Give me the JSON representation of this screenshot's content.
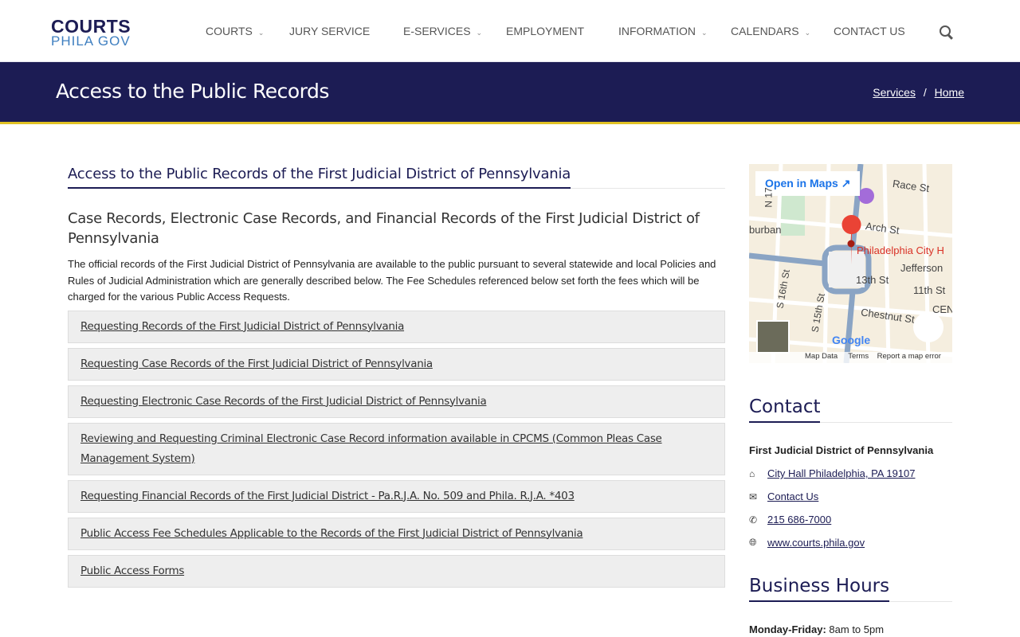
{
  "logo": {
    "line1": "COURTS",
    "line2": "PHILA GOV"
  },
  "nav": [
    {
      "label": "COURTS",
      "dropdown": true
    },
    {
      "label": "JURY SERVICE"
    },
    {
      "label": "E-SERVICES",
      "dropdown": true
    },
    {
      "label": "EMPLOYMENT"
    },
    {
      "label": "INFORMATION",
      "dropdown": true
    },
    {
      "label": "CALENDARS",
      "dropdown": true
    },
    {
      "label": "CONTACT US"
    }
  ],
  "banner": {
    "title": "Access to the Public Records",
    "breadcrumb": [
      "Services",
      "Home"
    ],
    "sep": "/"
  },
  "main": {
    "title": "Access to the Public Records of the First Judicial District of Pennsylvania",
    "subtitle": "Case Records, Electronic Case Records, and Financial Records of the First Judicial District of Pennsylvania",
    "intro": "The official records of the First Judicial District of Pennsylvania are available to the public pursuant to several statewide and local Policies and Rules of Judicial Administration which are generally described below. The Fee Schedules referenced below set forth the fees which will be charged for the various Public Access Requests.",
    "links": [
      "Requesting Records of the First Judicial District of Pennsylvania",
      "Requesting Case Records of the First Judicial District of Pennsylvania",
      "Requesting Electronic Case Records of the First Judicial District of Pennsylvania",
      "Reviewing and Requesting Criminal Electronic Case Record information available in CPCMS (Common Pleas Case Management System)",
      "Requesting Financial Records of the First Judicial District - Pa.R.J.A. No. 509 and Phila. R.J.A. *403",
      "Public Access Fee Schedules Applicable to the Records of the First Judicial District of Pennsylvania",
      "Public Access Forms"
    ]
  },
  "map": {
    "open": "Open in Maps",
    "place": "Philadelphia City H",
    "labels": [
      "Race St",
      "Arch St",
      "Jefferson",
      "13th St",
      "11th St",
      "CENT",
      "Chestnut St",
      "S 16th St",
      "S 15th St",
      "burban",
      "N 17"
    ],
    "footer": [
      "Map Data",
      "Terms",
      "Report a map error"
    ],
    "brand": "Google"
  },
  "contact": {
    "heading": "Contact",
    "org": "First Judicial District of Pennsylvania",
    "items": [
      {
        "icon": "home-icon",
        "text": "City Hall Philadelphia, PA 19107"
      },
      {
        "icon": "envelope-icon",
        "text": "Contact Us"
      },
      {
        "icon": "phone-icon",
        "text": "215 686-7000"
      },
      {
        "icon": "globe-icon",
        "text": "www.courts.phila.gov"
      }
    ]
  },
  "hours": {
    "heading": "Business Hours",
    "label": "Monday-Friday:",
    "value": "8am to 5pm"
  }
}
